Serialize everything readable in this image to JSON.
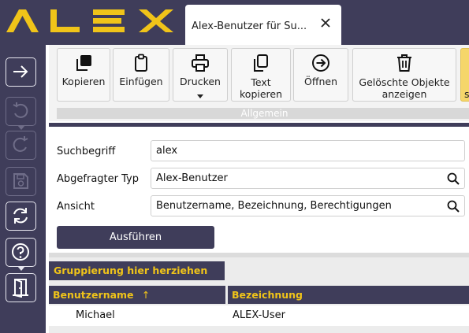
{
  "app": {
    "logo_text": "ALEX",
    "accent": "#f0c419",
    "dark": "#3f3d5a"
  },
  "tab": {
    "title": "Alex-Benutzer für Su...",
    "close_icon": "close-icon"
  },
  "sidebar": {
    "items": [
      {
        "icon": "arrow-right-icon",
        "enabled": true
      },
      {
        "icon": "undo-icon",
        "enabled": false
      },
      {
        "icon": "redo-icon",
        "enabled": false
      },
      {
        "icon": "save-icon",
        "enabled": false
      },
      {
        "icon": "refresh-icon",
        "enabled": true
      },
      {
        "icon": "help-icon",
        "enabled": true
      },
      {
        "icon": "exit-door-icon",
        "enabled": true
      }
    ]
  },
  "ribbon": {
    "buttons": [
      {
        "label": "Kopieren",
        "icon": "copy-icon"
      },
      {
        "label": "Einfügen",
        "icon": "clipboard-icon"
      },
      {
        "label": "Drucken",
        "icon": "printer-icon"
      },
      {
        "label": "Text kopieren",
        "icon": "copy-text-icon"
      },
      {
        "label": "Öffnen",
        "icon": "open-arrow-icon"
      },
      {
        "label": "Gelöschte Objekte anzeigen",
        "icon": "trash-icon"
      },
      {
        "label": "s",
        "icon": ""
      }
    ],
    "group_label": "Allgemein"
  },
  "form": {
    "search_label": "Suchbegriff",
    "search_value": "alex",
    "type_label": "Abgefragter Typ",
    "type_value": "Alex-Benutzer",
    "view_label": "Ansicht",
    "view_value": "Benutzername, Bezeichnung, Berechtigungen",
    "run_label": "Ausführen"
  },
  "grid": {
    "group_hint": "Gruppierung hier herziehen",
    "columns": [
      {
        "label": "Benutzername",
        "sort": "↑"
      },
      {
        "label": "Bezeichnung"
      }
    ],
    "rows": [
      {
        "benutzername": "Michael",
        "bezeichnung": "ALEX-User"
      }
    ]
  }
}
